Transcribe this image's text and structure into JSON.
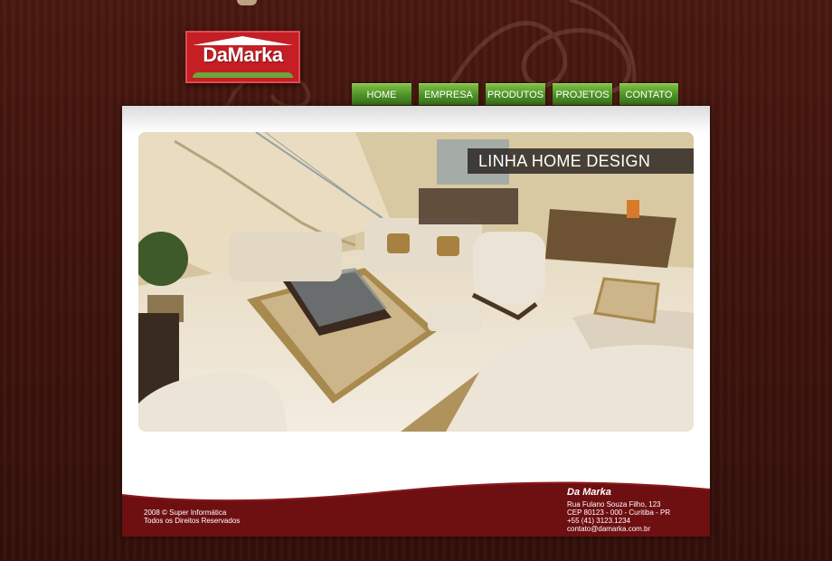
{
  "logo": {
    "brand": "DaMarka"
  },
  "nav": {
    "items": [
      {
        "label": "HOME"
      },
      {
        "label": "EMPRESA"
      },
      {
        "label": "PRODUTOS"
      },
      {
        "label": "PROJETOS"
      },
      {
        "label": "CONTATO"
      }
    ]
  },
  "hero": {
    "title": "LINHA HOME DESIGN"
  },
  "footer": {
    "copyright": "2008 © Super Informática",
    "rights": "Todos os Direitos Reservados",
    "company": "Da Marka",
    "address": "Rua Fulano Souza Filho, 123",
    "cep": "CEP 80123 - 000  - Curitiba - PR",
    "phone": "+55 (41) 3123.1234",
    "email": "contato@damarka.com.br"
  },
  "colors": {
    "background": "#3d130c",
    "logo_red": "#c51e25",
    "nav_green": "#5a9d2d",
    "footer_maroon": "#6e0f12"
  }
}
